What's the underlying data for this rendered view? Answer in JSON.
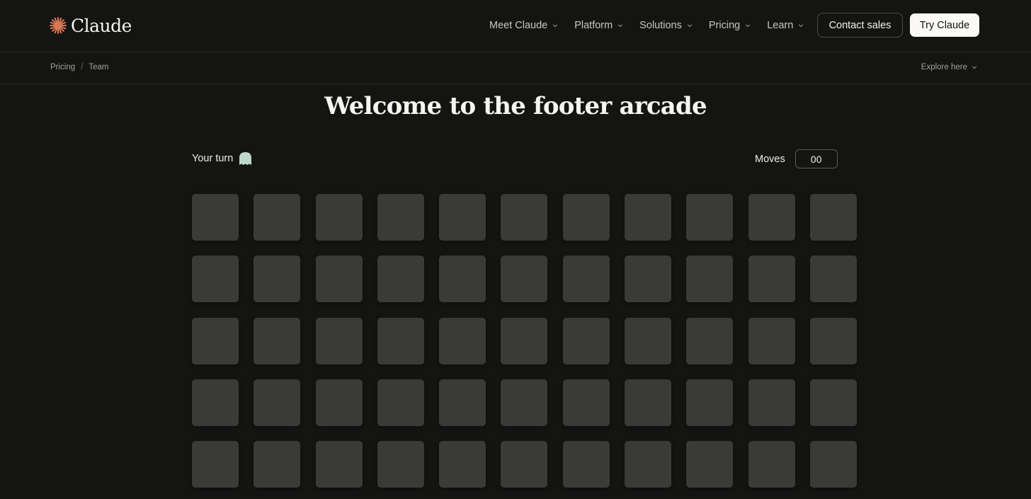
{
  "brand": {
    "name": "Claude",
    "accent": "#d97757"
  },
  "nav": {
    "items": [
      {
        "label": "Meet Claude",
        "name": "nav-meet-claude"
      },
      {
        "label": "Platform",
        "name": "nav-platform"
      },
      {
        "label": "Solutions",
        "name": "nav-solutions"
      },
      {
        "label": "Pricing",
        "name": "nav-pricing"
      },
      {
        "label": "Learn",
        "name": "nav-learn"
      }
    ],
    "contact_label": "Contact sales",
    "try_label": "Try Claude"
  },
  "breadcrumb": {
    "items": [
      "Pricing",
      "Team"
    ],
    "separator": "/"
  },
  "explore_label": "Explore here",
  "page": {
    "title": "Welcome to the footer arcade"
  },
  "game": {
    "turn_label": "Your turn",
    "turn_icon": "ghost-icon",
    "turn_icon_color": "#bfd8cc",
    "moves_label": "Moves",
    "moves_value": "00",
    "rows": 5,
    "cols": 11,
    "tile_color": "#3a3a38"
  }
}
